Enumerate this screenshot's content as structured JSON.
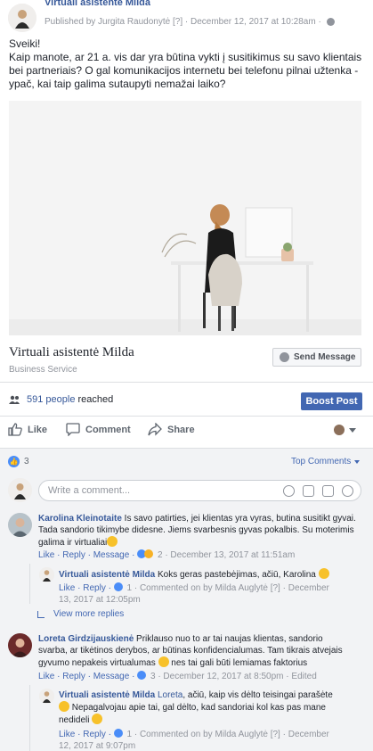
{
  "header": {
    "page_name": "Virtuali asistentė Milda",
    "published_by": "Published by Jurgita Raudonytė",
    "help_mark": "[?]",
    "timestamp": "December 12, 2017 at 10:28am"
  },
  "post": {
    "text": "Sveiki!\nKaip manote, ar 21 a. vis dar yra būtina vykti į susitikimus su savo klientais bei partneriais? O gal komunikacijos internetu bei telefonu pilnai užtenka - ypač, kai taip galima sutaupyti nemažai laiko?",
    "link_title": "Virtuali asistentė Milda",
    "link_subtitle": "Business Service",
    "send_message_label": "Send Message"
  },
  "stats": {
    "reach_count": "591 people",
    "reach_suffix": "reached",
    "boost_label": "Boost Post"
  },
  "actions": {
    "like": "Like",
    "comment": "Comment",
    "share": "Share"
  },
  "comments_section": {
    "reaction_count": "3",
    "sort_label": "Top Comments",
    "write_placeholder": "Write a comment...",
    "view_more": "View more replies",
    "items": [
      {
        "author": "Karolina Kleinotaite",
        "text": " Is savo patirties, jei klientas yra vyras, butina susitikt gyvai. Tada sandorio tikimybe didesne. Jiems svarbesnis gyvas pokalbis. Su moterimis galima ir virtualiai",
        "like": "Like",
        "reply": "Reply",
        "message": "Message",
        "reactions": "2",
        "time": "December 13, 2017 at 11:51am"
      },
      {
        "author": "Virtuali asistentė Milda",
        "text": " Koks geras pastebėjimas, ačiū, Karolina",
        "like": "Like",
        "reply": "Reply",
        "reactions": "1",
        "commented_on_by": "Commented on by Milda Auglytė",
        "help_mark": "[?]",
        "time_line1": "December",
        "time_line2": "13, 2017 at 12:05pm"
      },
      {
        "author": "Loreta Girdzijauskienė",
        "text": " Priklauso nuo to ar tai naujas klientas, sandorio svarba, ar tikėtinos derybos, ar būtinas konfidencialumas. Tam tikrais atvejais gyvumo nepakeis virtualumas",
        "text_tail": " nes tai gali būti lemiamas faktorius",
        "like": "Like",
        "reply": "Reply",
        "message": "Message",
        "reactions": "3",
        "time": "December 12, 2017 at 8:50pm",
        "edited": "Edited"
      },
      {
        "author": "Virtuali asistentė Milda",
        "mention": "Loreta",
        "text": ", ačiū, kaip vis dėlto teisingai parašėte",
        "text_line2": " Nepagalvojau apie tai, gal dėlto, kad sandoriai kol kas pas mane nedideli",
        "like": "Like",
        "reply": "Reply",
        "reactions": "1",
        "commented_on_by": "Commented on by Milda Auglytė",
        "help_mark": "[?]",
        "time_line1": "December",
        "time_line2": "12, 2017 at 9:07pm"
      }
    ]
  },
  "colors": {
    "link_blue": "#365899",
    "boost_blue": "#4267b2",
    "muted_gray": "#90949c",
    "comments_bg": "#f2f3f5"
  },
  "icons": [
    "people-icon",
    "like-icon",
    "comment-icon",
    "share-icon",
    "globe-icon",
    "messenger-icon",
    "emoji-icon",
    "camera-icon",
    "gif-icon",
    "sticker-icon",
    "reply-arrow-icon"
  ]
}
